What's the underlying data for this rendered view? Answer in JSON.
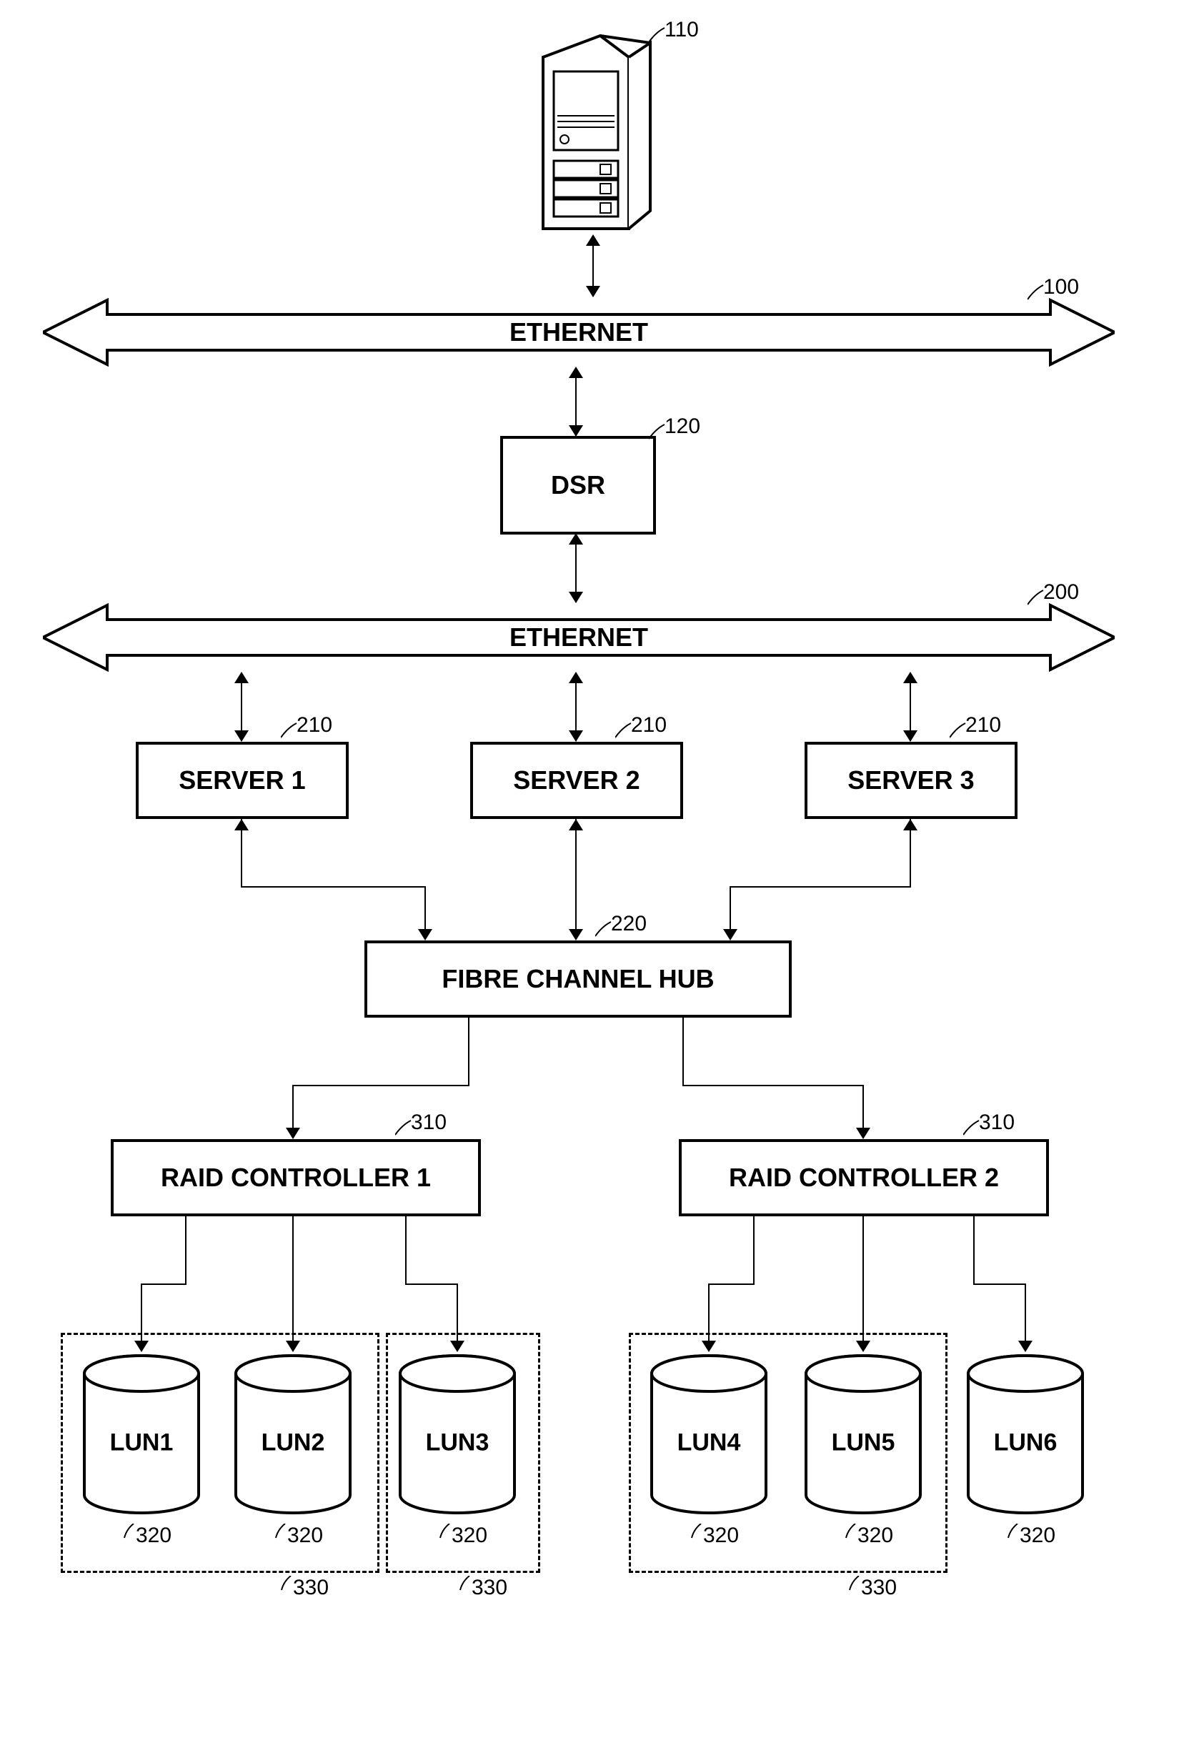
{
  "refs": {
    "tower": "110",
    "ethernet1": "100",
    "dsr": "120",
    "ethernet2": "200",
    "server": "210",
    "hub": "220",
    "raid": "310",
    "lun": "320",
    "group": "330"
  },
  "labels": {
    "ethernet": "ETHERNET",
    "dsr": "DSR",
    "server1": "SERVER 1",
    "server2": "SERVER 2",
    "server3": "SERVER 3",
    "hub": "FIBRE CHANNEL HUB",
    "raid1": "RAID CONTROLLER 1",
    "raid2": "RAID CONTROLLER 2",
    "lun1": "LUN1",
    "lun2": "LUN2",
    "lun3": "LUN3",
    "lun4": "LUN4",
    "lun5": "LUN5",
    "lun6": "LUN6"
  }
}
